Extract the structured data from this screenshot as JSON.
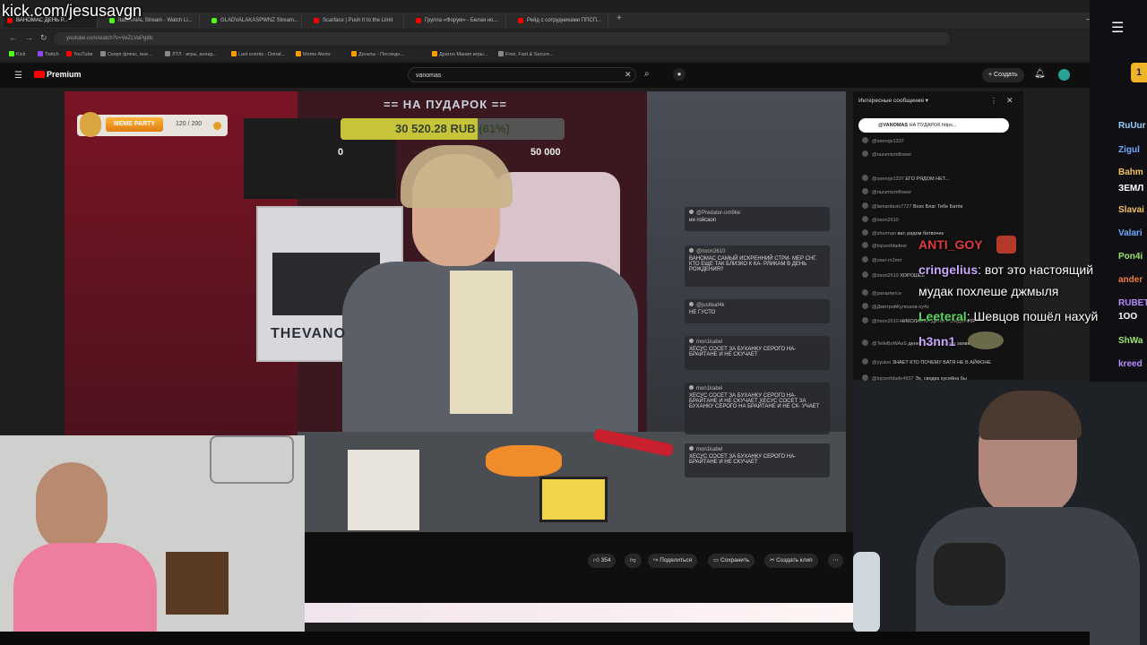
{
  "overlay": {
    "channel_url": "kick.com/jesusavgn"
  },
  "browser": {
    "tabs": [
      "ВАНОМАС ДЕНЬ Р...",
      "ItaoLeNAL Stream - Watch Li...",
      "GLADVALAKASPWNZ Stream...",
      "Scarface | Push It to the Limit",
      "Группа «Форум» - Белая но...",
      "Рейд с сотрудниками ППСП..."
    ],
    "url": "youtube.com/watch?v=VeZLVaPg8lc",
    "bookmarks": [
      "Kick",
      "Twitch",
      "YouTube",
      "Скорп флекс, вне...",
      "ЛТЛ - игры, анекд...",
      "Last events - Donat...",
      "Meme Alerts",
      "Донаты - Последн...",
      "Драгон Мания игры...",
      "Free, Fast & Secure..."
    ]
  },
  "youtube": {
    "logo": "Premium",
    "search_value": "vanomas",
    "create_label": "Создать"
  },
  "video": {
    "meme_party": {
      "label": "MEME PARTY",
      "count": "120 / 200"
    },
    "donation": {
      "title": "== НА ПУДАРОК ==",
      "amount": "30 520.28 RUB (61%)",
      "progress": 0.61,
      "min": "0",
      "max": "50 000"
    },
    "studio_sign": "THEVANO",
    "onscreen_chat": [
      {
        "user": "@Predator-om9ke",
        "text": "ии гойсаоп"
      },
      {
        "user": "@rixon2610",
        "text": "ВАНОМАС САМЫЙ ИСКРЕННИЙ СТРИ- МЕР СНГ. КТО ЕЩЕ ТАК БЛИЗКО К КА- РЛИКАМ В ДЕНЬ РОЖДЕНИЯ?"
      },
      {
        "user": "@justleaf4k",
        "text": "НЕ ГУСТО"
      },
      {
        "user": "mon1kabel",
        "text": "ХЕСУС СОСЕТ ЗА БУХАНКУ СЕРОГО НА- БРАЙТАНЕ И НЕ СКУЧАЕТ"
      },
      {
        "user": "mon1kabel",
        "text": "ХЕСУС СОСЕТ ЗА БУХАНКУ СЕРОГО НА- БРАЙТАНЕ И НЕ СКУЧАЕТ ХЕСУС СОСЕТ ЗА БУХАНКУ СЕРОГО НА БРАЙТАНЕ И НЕ СК- УЧАЕТ"
      },
      {
        "user": "mon1kabel",
        "text": "ХЕСУС СОСЕТ ЗА БУХАНКУ СЕРОГО НА- БРАЙТАНЕ И НЕ СКУЧАЕТ"
      }
    ]
  },
  "actions": {
    "likes": "354",
    "share": "Поделиться",
    "save": "Сохранить",
    "clip": "Создать клип"
  },
  "yt_chat": {
    "header": "Интересные сообщения",
    "pinned": {
      "user": "@VANOMAS",
      "text": "НА ПУДАРОК https..."
    },
    "messages": [
      {
        "user": "@seeroje1337",
        "text": ""
      },
      {
        "user": "@razumizmflower",
        "text": ""
      },
      {
        "user": "@seeroje1337",
        "text": "ЕГО РЯДОМ НЕТ..."
      },
      {
        "user": "@razumizmflower",
        "text": ""
      },
      {
        "user": "@lamardavis7727",
        "text": "Всех Благ Тебе Батёк"
      },
      {
        "user": "@rixon2610",
        "text": ""
      },
      {
        "user": "@shurman",
        "text": "ват, ридом битвочек"
      },
      {
        "user": "@topserbladeer",
        "text": ""
      },
      {
        "user": "@user-rx1mn",
        "text": ""
      },
      {
        "user": "@rixon2610",
        "text": "ХОРОШЕЕ"
      },
      {
        "user": "@panamerce",
        "text": ""
      },
      {
        "user": "@ДмитрийКулешов-oy4z",
        "text": ""
      },
      {
        "user": "@rixon2610",
        "text": "НИКОЛАЕВА ДЕНЬ РОЖДЕНИЯ"
      },
      {
        "user": "@TelleBoWAaS",
        "text": "денег, так что заявки заявки"
      },
      {
        "user": "@yyukei",
        "text": "ЗНАЕТ КТО ПОЧЕМУ БАТЯ НЕ В АЙФОНЕ"
      },
      {
        "user": "@topserblade4957",
        "text": "Эх, сводка хусейна бы"
      }
    ]
  },
  "kick_chat": [
    {
      "name": "ANTI_GOY",
      "text": "",
      "color": "#e33b3b"
    },
    {
      "name": "cringelius",
      "text": ": вот это настоящий",
      "color": "#c9a8ff"
    },
    {
      "name": "",
      "text": "мудак похлеше джмыля",
      "color": "#ffffff"
    },
    {
      "name": "Leeteral",
      "text": ": Шевцов пошёл нахуй",
      "color": "#5cd65c"
    },
    {
      "name": "h3nn1",
      "text": "",
      "color": "#c9a8ff"
    }
  ],
  "right_panel": {
    "badge": "1",
    "names": [
      {
        "text": "RuUur",
        "color": "#8fd3ff"
      },
      {
        "text": "Zigul",
        "color": "#6fa8ff"
      },
      {
        "text": "Bahm",
        "color": "#f0c060"
      },
      {
        "text": "ЗЕМЛ",
        "color": "#ffffff"
      },
      {
        "text": "Slavai",
        "color": "#f0c060"
      },
      {
        "text": "Valari",
        "color": "#6fa8ff"
      },
      {
        "text": "Pon4i",
        "color": "#9be36b"
      },
      {
        "text": "ander",
        "color": "#f07a3a"
      },
      {
        "text": "RUBET",
        "color": "#b58cff"
      },
      {
        "text": "1ОО",
        "color": "#ffffff"
      },
      {
        "text": "ShWa",
        "color": "#9be36b"
      },
      {
        "text": "kreed",
        "color": "#b58cff"
      }
    ]
  },
  "colors": {
    "yt_red": "#ff0000",
    "donation_fill": "#c8c43a",
    "meme_orange": "#f39a22"
  }
}
